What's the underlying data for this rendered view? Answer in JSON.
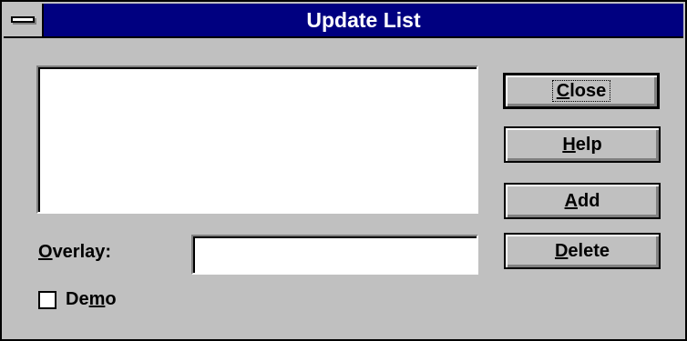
{
  "window": {
    "title": "Update List"
  },
  "list": {
    "items": []
  },
  "buttons": {
    "close": {
      "pre": "",
      "mnemonic": "C",
      "post": "lose"
    },
    "help": {
      "pre": "",
      "mnemonic": "H",
      "post": "elp"
    },
    "add": {
      "pre": "",
      "mnemonic": "A",
      "post": "dd"
    },
    "delete": {
      "pre": "",
      "mnemonic": "D",
      "post": "elete"
    }
  },
  "overlay": {
    "label_pre": "",
    "label_mnemonic": "O",
    "label_post": "verlay:",
    "value": ""
  },
  "demo": {
    "label_pre": "De",
    "label_mnemonic": "m",
    "label_post": "o",
    "checked": false
  },
  "colors": {
    "title_bar": "#000080",
    "face": "#c0c0c0"
  }
}
